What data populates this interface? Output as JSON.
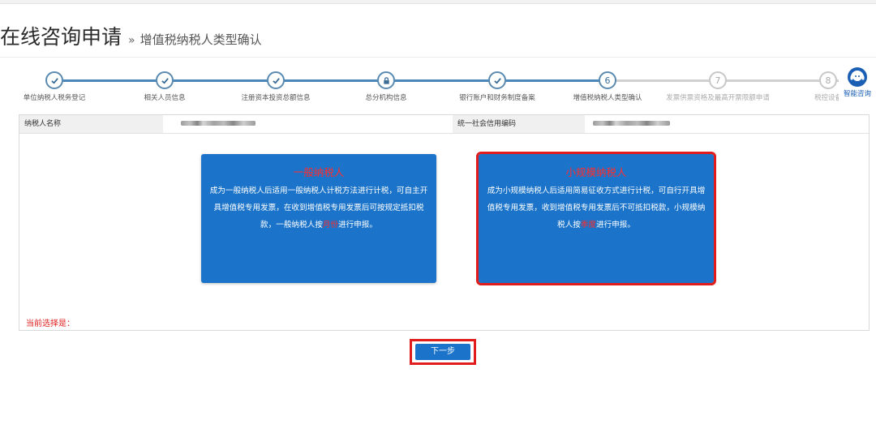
{
  "header": {
    "title": "在线咨询申请",
    "separator": "»",
    "subtitle": "增值税纳税人类型确认"
  },
  "steps": [
    {
      "number": "1",
      "label": "单位纳税人税务登记",
      "status": "done",
      "icon": "check-icon"
    },
    {
      "number": "2",
      "label": "相关人员信息",
      "status": "done",
      "icon": "check-icon"
    },
    {
      "number": "3",
      "label": "注册资本投资总额信息",
      "status": "done",
      "icon": "check-icon"
    },
    {
      "number": "4",
      "label": "总分机构信息",
      "status": "done",
      "icon": "lock-icon"
    },
    {
      "number": "5",
      "label": "银行账户和财务制度备案",
      "status": "done",
      "icon": "check-icon"
    },
    {
      "number": "6",
      "label": "增值税纳税人类型确认",
      "status": "current",
      "icon": "number"
    },
    {
      "number": "7",
      "label": "发票供票资格及最高开票限额申请",
      "status": "todo",
      "icon": "number"
    },
    {
      "number": "8",
      "label": "税控设备",
      "status": "todo",
      "icon": "number"
    }
  ],
  "help": {
    "label": "智能咨询",
    "icon": "customer-service-icon"
  },
  "info": {
    "taxpayer_name_label": "纳税人名称",
    "credit_code_label": "统一社会信用编码"
  },
  "cards": {
    "general": {
      "title": "一般纳税人",
      "desc_before": "成为一般纳税人后适用一般纳税人计税方法进行计税，可自主开具增值税专用发票，在收到增值税专用发票后可按规定抵扣税款，一般纳税人按",
      "desc_emph": "月份",
      "desc_after": "进行申报。"
    },
    "small": {
      "title": "小规模纳税人",
      "desc_before": "成为小规模纳税人后适用简易征收方式进行计税，可自行开具增值税专用发票，收到增值税专用发票后不可抵扣税款，小规模纳税人按",
      "desc_emph": "季度",
      "desc_after": "进行申报。"
    }
  },
  "current_selection_label": "当前选择是：",
  "next_button": "下一步",
  "colors": {
    "primary": "#1b74c9",
    "highlight_red": "#e11c1c",
    "step_done": "#4a86b8",
    "step_todo": "#d0d0d0"
  }
}
